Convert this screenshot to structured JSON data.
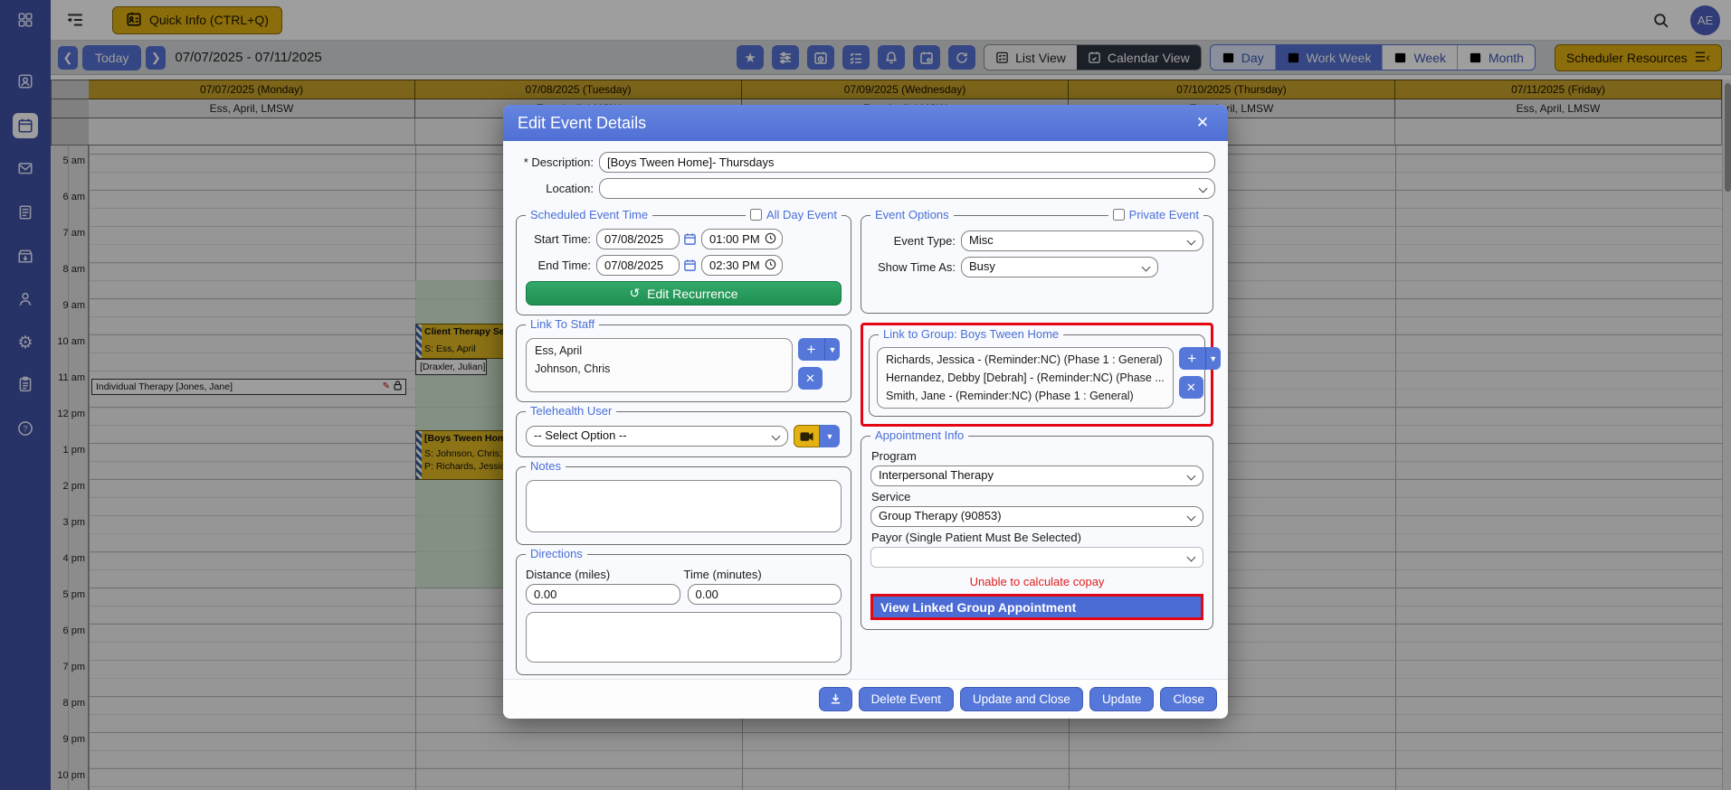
{
  "topbar": {
    "quick_info": "Quick Info (CTRL+Q)",
    "avatar": "AE"
  },
  "toolbar": {
    "today": "Today",
    "date_range": "07/07/2025 - 07/11/2025",
    "list_view": "List View",
    "calendar_view": "Calendar View",
    "day": "Day",
    "work_week": "Work Week",
    "week": "Week",
    "month": "Month",
    "scheduler_resources": "Scheduler Resources"
  },
  "calendar": {
    "days": [
      {
        "date": "07/07/2025 (Monday)",
        "staff": "Ess, April, LMSW"
      },
      {
        "date": "07/08/2025 (Tuesday)",
        "staff": "Ess, April, LMSW"
      },
      {
        "date": "07/09/2025 (Wednesday)",
        "staff": "Ess, April, LMSW"
      },
      {
        "date": "07/10/2025 (Thursday)",
        "staff": "Ess, April, LMSW"
      },
      {
        "date": "07/11/2025 (Friday)",
        "staff": "Ess, April, LMSW"
      }
    ],
    "times": [
      "5 am",
      "6 am",
      "7 am",
      "8 am",
      "9 am",
      "10 am",
      "11 am",
      "12 pm",
      "1 pm",
      "2 pm",
      "3 pm",
      "4 pm",
      "5 pm",
      "6 pm",
      "7 pm",
      "8 pm",
      "9 pm",
      "10 pm"
    ],
    "events": [
      {
        "lines": [
          "Individual Therapy [Jones, Jane]"
        ]
      },
      {
        "lines": [
          "Client Therapy Session",
          "S: Ess, April"
        ]
      },
      {
        "lines": [
          "[Draxler, Julian]"
        ]
      },
      {
        "lines": [
          "[Boys Tween Home]-",
          "S: Johnson, Chris; Es",
          "P: Richards, Jessica; H"
        ]
      }
    ]
  },
  "modal": {
    "title": "Edit Event Details",
    "description_label": "* Description:",
    "description_value": "[Boys Tween Home]- Thursdays",
    "location_label": "Location:",
    "scheduled": {
      "legend": "Scheduled Event Time",
      "all_day": "All Day Event",
      "start_label": "Start Time:",
      "start_date": "07/08/2025",
      "start_time": "01:00 PM",
      "end_label": "End Time:",
      "end_date": "07/08/2025",
      "end_time": "02:30 PM",
      "edit_recurrence": "Edit Recurrence"
    },
    "event_options": {
      "legend": "Event Options",
      "private_event": "Private Event",
      "event_type_label": "Event Type:",
      "event_type_value": "Misc",
      "show_time_label": "Show Time As:",
      "show_time_value": "Busy"
    },
    "link_staff": {
      "legend": "Link To Staff",
      "items": [
        "Ess, April",
        "Johnson, Chris"
      ]
    },
    "link_group": {
      "legend": "Link to Group: Boys Tween Home",
      "items": [
        "Richards, Jessica - (Reminder:NC) (Phase 1 : General)",
        "Hernandez, Debby [Debrah] - (Reminder:NC) (Phase ...",
        "Smith, Jane - (Reminder:NC) (Phase 1 : General)"
      ]
    },
    "telehealth": {
      "legend": "Telehealth User",
      "selected": "-- Select Option --"
    },
    "notes": {
      "legend": "Notes"
    },
    "directions": {
      "legend": "Directions",
      "distance_label": "Distance (miles)",
      "distance_value": "0.00",
      "time_label": "Time (minutes)",
      "time_value": "0.00"
    },
    "appointment": {
      "legend": "Appointment Info",
      "program_label": "Program",
      "program_value": "Interpersonal Therapy",
      "service_label": "Service",
      "service_value": "Group Therapy (90853)",
      "payor_label": "Payor (Single Patient Must Be Selected)",
      "copay_warning": "Unable to calculate copay",
      "view_linked": "View Linked Group Appointment"
    },
    "footer": {
      "delete": "Delete Event",
      "update_close": "Update and Close",
      "update": "Update",
      "close": "Close"
    }
  },
  "colors": {
    "accent_blue": "#5472d3",
    "sidebar_navy": "#3f51a5",
    "header_gold": "#c9a22b",
    "event_gold": "#e3ba25",
    "recurrence_green": "#27a05e",
    "highlight_red": "#e40613",
    "copay_red": "#e01c1c",
    "quick_info_yellow": "#e3b112"
  }
}
